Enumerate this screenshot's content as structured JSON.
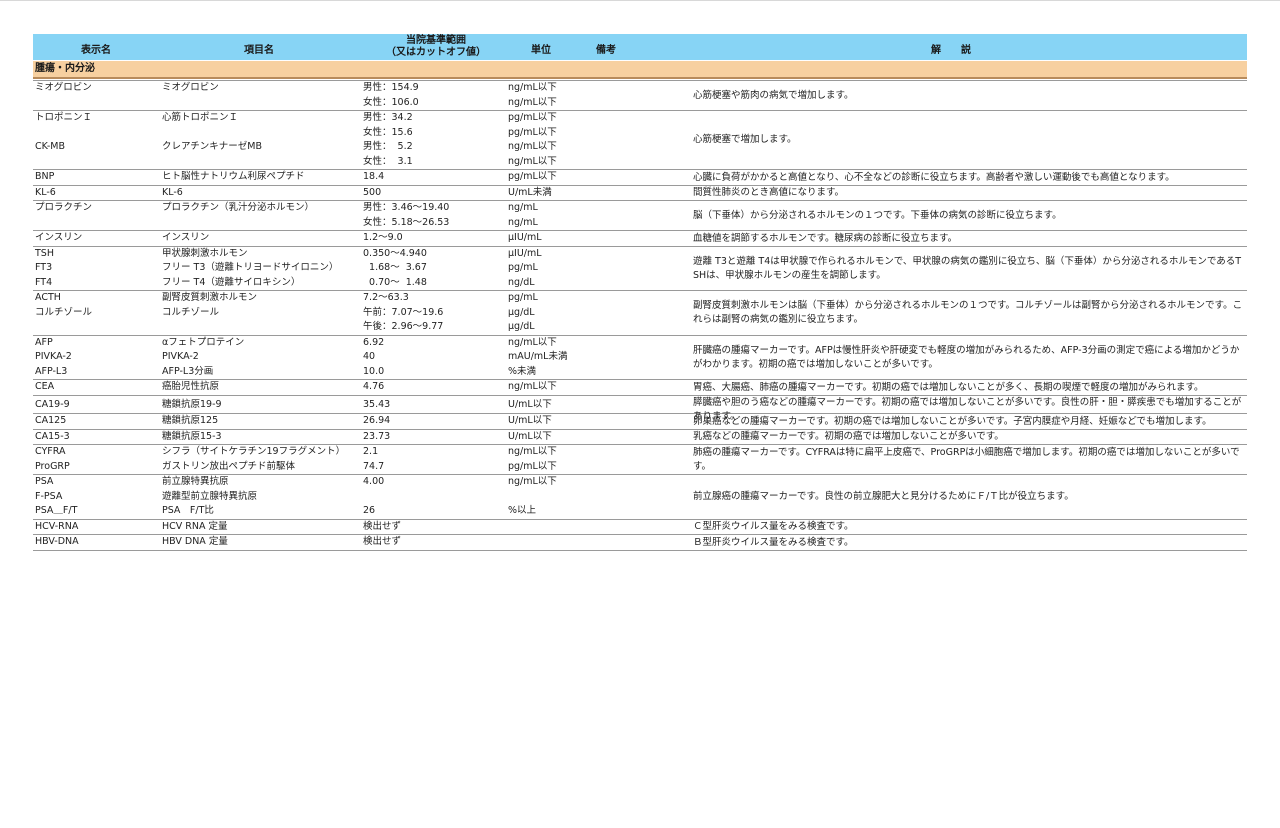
{
  "header": {
    "disp": "表示名",
    "item": "項目名",
    "range_line1": "当院基準範囲",
    "range_line2": "（又はカットオフ値）",
    "unit": "単位",
    "remarks": "備考",
    "explanation": "解　　説"
  },
  "section": "腫瘍・内分泌",
  "groups": [
    {
      "rows": [
        {
          "disp": "ミオグロビン",
          "item": "ミオグロビン",
          "range": "男性：154.9",
          "unit": "ng/mL以下"
        },
        {
          "disp": "",
          "item": "",
          "range": "女性：106.0",
          "unit": "ng/mL以下"
        }
      ],
      "note": "心筋梗塞や筋肉の病気で増加します。"
    },
    {
      "rows": [
        {
          "disp": "トロポニンＩ",
          "item": "心筋トロポニンＩ",
          "range": "男性：34.2",
          "unit": "pg/mL以下"
        },
        {
          "disp": "",
          "item": "",
          "range": "女性：15.6",
          "unit": "pg/mL以下"
        },
        {
          "disp": "CK-MB",
          "item": "クレアチンキナーゼMB",
          "range": "男性：  5.2",
          "unit": "ng/mL以下"
        },
        {
          "disp": "",
          "item": "",
          "range": "女性：  3.1",
          "unit": "ng/mL以下"
        }
      ],
      "note": "心筋梗塞で増加します。"
    },
    {
      "rows": [
        {
          "disp": "BNP",
          "item": "ヒト脳性ナトリウム利尿ペプチド",
          "range": "18.4",
          "unit": "pg/mL以下"
        }
      ],
      "note": "心臓に負荷がかかると高値となり、心不全などの診断に役立ちます。高齢者や激しい運動後でも高値となります。"
    },
    {
      "rows": [
        {
          "disp": "KL-6",
          "item": "KL-6",
          "range": "500",
          "unit": "U/mL未満"
        }
      ],
      "note": "間質性肺炎のとき高値になります。"
    },
    {
      "rows": [
        {
          "disp": "プロラクチン",
          "item": "プロラクチン（乳汁分泌ホルモン）",
          "range": "男性：3.46〜19.40",
          "unit": "ng/mL"
        },
        {
          "disp": "",
          "item": "",
          "range": "女性：5.18〜26.53",
          "unit": "ng/mL"
        }
      ],
      "note": "脳（下垂体）から分泌されるホルモンの１つです。下垂体の病気の診断に役立ちます。"
    },
    {
      "rows": [
        {
          "disp": "インスリン",
          "item": "インスリン",
          "range": "1.2〜9.0",
          "unit": "μIU/mL"
        }
      ],
      "note": "血糖値を調節するホルモンです。糖尿病の診断に役立ちます。"
    },
    {
      "rows": [
        {
          "disp": "TSH",
          "item": "甲状腺刺激ホルモン",
          "range": "0.350〜4.940",
          "unit": "μIU/mL"
        },
        {
          "disp": "FT3",
          "item": "フリー T3（遊離トリヨードサイロニン）",
          "range": "  1.68〜  3.67",
          "unit": "pg/mL"
        },
        {
          "disp": "FT4",
          "item": "フリー T4（遊離サイロキシン）",
          "range": "  0.70〜  1.48",
          "unit": "ng/dL"
        }
      ],
      "note": "遊離 T3と遊離 T4は甲状腺で作られるホルモンで、甲状腺の病気の鑑別に役立ち、脳（下垂体）から分泌されるホルモンであるTSHは、甲状腺ホルモンの産生を調節します。"
    },
    {
      "rows": [
        {
          "disp": "ACTH",
          "item": "副腎皮質刺激ホルモン",
          "range": "7.2〜63.3",
          "unit": "pg/mL"
        },
        {
          "disp": "コルチゾール",
          "item": "コルチゾール",
          "range": "午前：7.07〜19.6",
          "unit": "μg/dL"
        },
        {
          "disp": "",
          "item": "",
          "range": "午後：2.96〜9.77",
          "unit": "μg/dL"
        }
      ],
      "note": "副腎皮質刺激ホルモンは脳（下垂体）から分泌されるホルモンの１つです。コルチゾールは副腎から分泌されるホルモンです。これらは副腎の病気の鑑別に役立ちます。"
    },
    {
      "rows": [
        {
          "disp": "AFP",
          "item": "αフェトプロテイン",
          "range": "6.92",
          "unit": "ng/mL以下"
        },
        {
          "disp": "PIVKA-2",
          "item": "PIVKA-2",
          "range": "40",
          "unit": "mAU/mL未満"
        },
        {
          "disp": "AFP-L3",
          "item": "AFP-L3分画",
          "range": "10.0",
          "unit": "%未満"
        }
      ],
      "note": "肝臓癌の腫瘍マーカーです。AFPは慢性肝炎や肝硬変でも軽度の増加がみられるため、AFP-3分画の測定で癌による増加かどうかがわかります。初期の癌では増加しないことが多いです。"
    },
    {
      "rows": [
        {
          "disp": "CEA",
          "item": "癌胎児性抗原",
          "range": "4.76",
          "unit": "ng/mL以下"
        }
      ],
      "note": "胃癌、大腸癌、肺癌の腫瘍マーカーです。初期の癌では増加しないことが多く、長期の喫煙で軽度の増加がみられます。"
    },
    {
      "rows": [
        {
          "disp": "CA19-9",
          "item": "糖鎖抗原19-9",
          "range": "35.43",
          "unit": "U/mL以下"
        }
      ],
      "note": "膵臓癌や胆のう癌などの腫瘍マーカーです。初期の癌では増加しないことが多いです。良性の肝・胆・膵疾患でも増加することがあります。",
      "tall": true
    },
    {
      "rows": [
        {
          "disp": "CA125",
          "item": "糖鎖抗原125",
          "range": "26.94",
          "unit": "U/mL以下"
        }
      ],
      "note": "卵巣癌などの腫瘍マーカーです。初期の癌では増加しないことが多いです。子宮内膜症や月経、妊娠などでも増加します。"
    },
    {
      "rows": [
        {
          "disp": "CA15-3",
          "item": "糖鎖抗原15-3",
          "range": "23.73",
          "unit": "U/mL以下"
        }
      ],
      "note": "乳癌などの腫瘍マーカーです。初期の癌では増加しないことが多いです。"
    },
    {
      "rows": [
        {
          "disp": "CYFRA",
          "item": "シフラ（サイトケラチン19フラグメント）",
          "range": "2.1",
          "unit": "ng/mL以下"
        },
        {
          "disp": "ProGRP",
          "item": "ガストリン放出ペプチド前駆体",
          "range": "74.7",
          "unit": "pg/mL以下"
        }
      ],
      "note": "肺癌の腫瘍マーカーです。CYFRAは特に扁平上皮癌で、ProGRPは小細胞癌で増加します。初期の癌では増加しないことが多いです。"
    },
    {
      "rows": [
        {
          "disp": "PSA",
          "item": "前立腺特異抗原",
          "range": "4.00",
          "unit": "ng/mL以下"
        },
        {
          "disp": "F-PSA",
          "item": "遊離型前立腺特異抗原",
          "range": "",
          "unit": ""
        },
        {
          "disp": "PSA＿F/T",
          "item": "PSA　F/T比",
          "range": "26",
          "unit": "%以上"
        }
      ],
      "note": "前立腺癌の腫瘍マーカーです。良性の前立腺肥大と見分けるためにＦ/Ｔ比が役立ちます。"
    },
    {
      "rows": [
        {
          "disp": "HCV-RNA",
          "item": "HCV RNA 定量",
          "range": "検出せず",
          "unit": ""
        }
      ],
      "note": "Ｃ型肝炎ウイルス量をみる検査です。"
    },
    {
      "rows": [
        {
          "disp": "HBV-DNA",
          "item": "HBV DNA 定量",
          "range": "検出せず",
          "unit": ""
        }
      ],
      "note": "Ｂ型肝炎ウイルス量をみる検査です。"
    }
  ]
}
